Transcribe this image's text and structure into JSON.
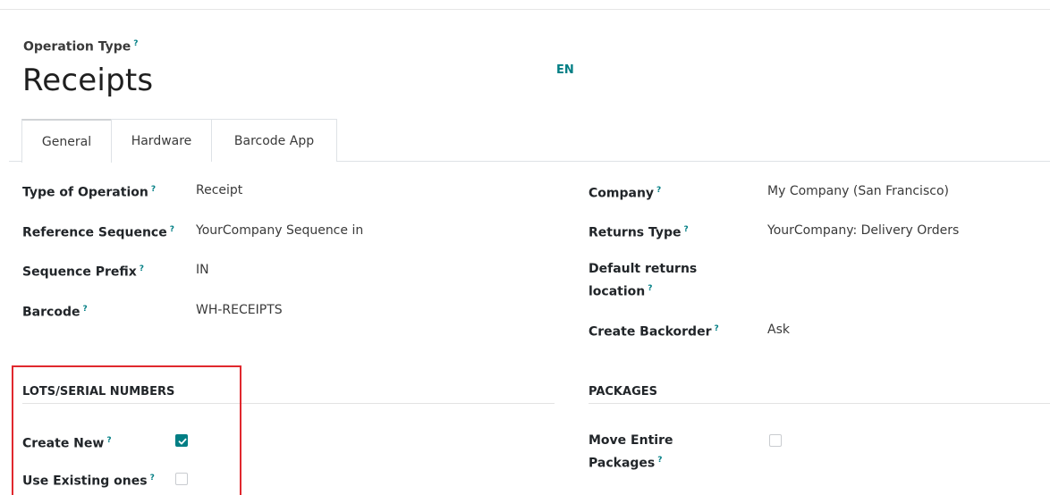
{
  "header": {
    "record_type_label": "Operation Type",
    "help_mark": "?",
    "title": "Receipts",
    "language": "EN"
  },
  "tabs": [
    {
      "label": "General",
      "active": true
    },
    {
      "label": "Hardware",
      "active": false
    },
    {
      "label": "Barcode App",
      "active": false
    }
  ],
  "left_fields": [
    {
      "label": "Type of Operation",
      "value": "Receipt"
    },
    {
      "label": "Reference Sequence",
      "value": "YourCompany Sequence in"
    },
    {
      "label": "Sequence Prefix",
      "value": "IN"
    },
    {
      "label": "Barcode",
      "value": "WH-RECEIPTS"
    }
  ],
  "right_fields": {
    "company": {
      "label": "Company",
      "value": "My Company (San Francisco)"
    },
    "returns_type": {
      "label": "Returns Type",
      "value": "YourCompany: Delivery Orders"
    },
    "default_returns_location": {
      "label_line1": "Default returns",
      "label_line2": "location",
      "value": ""
    },
    "create_backorder": {
      "label": "Create Backorder",
      "value": "Ask"
    }
  },
  "lots_section": {
    "title": "LOTS/SERIAL NUMBERS",
    "create_new": {
      "label": "Create New",
      "checked": true
    },
    "use_existing": {
      "label": "Use Existing ones",
      "checked": false
    }
  },
  "packages_section": {
    "title": "PACKAGES",
    "move_entire": {
      "label_line1": "Move Entire",
      "label_line2": "Packages",
      "checked": false
    }
  },
  "colors": {
    "accent": "#017e84",
    "highlight": "#e0282e"
  }
}
